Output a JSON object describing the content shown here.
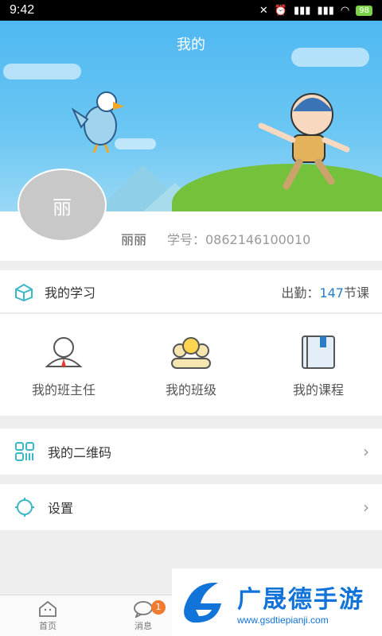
{
  "status_bar": {
    "time": "9:42",
    "battery": "98"
  },
  "header": {
    "title": "我的"
  },
  "profile": {
    "avatar_text": "丽",
    "name": "丽丽",
    "student_id": "学号：0862146100010"
  },
  "study": {
    "label": "我的学习",
    "attendance_prefix": "出勤：",
    "attendance_value": "147",
    "attendance_suffix": "节课"
  },
  "grid": [
    {
      "label": "我的班主任"
    },
    {
      "label": "我的班级"
    },
    {
      "label": "我的课程"
    }
  ],
  "qrcode": {
    "label": "我的二维码"
  },
  "settings": {
    "label": "设置"
  },
  "tabs": [
    {
      "label": "首页"
    },
    {
      "label": "消息",
      "badge": "1"
    }
  ],
  "watermark": {
    "main": "广晟德手游",
    "sub": "www.gsdtiepianji.com"
  },
  "colors": {
    "header": "#4fb8f1",
    "accent": "#2a7cc7",
    "badge": "#f07b2e"
  }
}
